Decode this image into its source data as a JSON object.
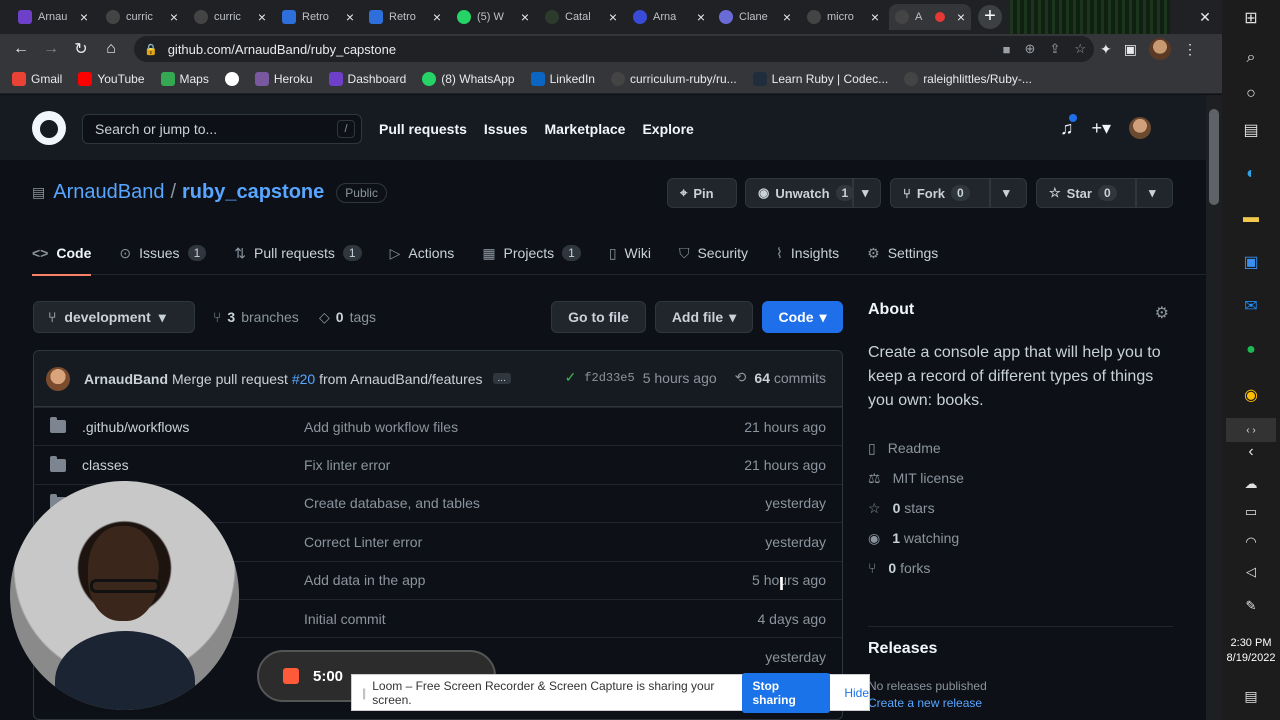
{
  "browser": {
    "tabs": [
      {
        "title": "Arnau",
        "color": "#6e40c9"
      },
      {
        "title": "curric",
        "color": "#444"
      },
      {
        "title": "curric",
        "color": "#444"
      },
      {
        "title": "Retro",
        "color": "#2f6fdb"
      },
      {
        "title": "Retro",
        "color": "#2f6fdb"
      },
      {
        "title": "(5) W",
        "color": "#25d366"
      },
      {
        "title": "Catal",
        "color": "#2d3b2d"
      },
      {
        "title": "Arna",
        "color": "#3a4bd8"
      },
      {
        "title": "Clane",
        "color": "#6b6bd8"
      },
      {
        "title": "micro",
        "color": "#444"
      },
      {
        "title": "A",
        "color": "#444"
      }
    ],
    "new_tab": "+",
    "url": "github.com/ArnaudBand/ruby_capstone",
    "bookmarks": [
      {
        "label": "Gmail",
        "color": "#ea4335"
      },
      {
        "label": "YouTube",
        "color": "#ff0000"
      },
      {
        "label": "Maps",
        "color": "#34a853"
      },
      {
        "label": "",
        "color": "#ffffff"
      },
      {
        "label": "Heroku",
        "color": "#79589f"
      },
      {
        "label": "Dashboard",
        "color": "#6e40c9"
      },
      {
        "label": "(8) WhatsApp",
        "color": "#25d366"
      },
      {
        "label": "LinkedIn",
        "color": "#0a66c2"
      },
      {
        "label": "curriculum-ruby/ru...",
        "color": "#444"
      },
      {
        "label": "Learn Ruby | Codec...",
        "color": "#1f2d3d"
      },
      {
        "label": "raleighlittles/Ruby-...",
        "color": "#444"
      }
    ]
  },
  "github": {
    "search_placeholder": "Search or jump to...",
    "search_key": "/",
    "nav": [
      "Pull requests",
      "Issues",
      "Marketplace",
      "Explore"
    ],
    "owner": "ArnaudBand",
    "repo": "ruby_capstone",
    "visibility": "Public",
    "pin": "Pin",
    "unwatch": "Unwatch",
    "unwatch_count": "1",
    "fork": "Fork",
    "fork_count": "0",
    "star": "Star",
    "star_count": "0",
    "tabs": [
      {
        "label": "Code",
        "count": ""
      },
      {
        "label": "Issues",
        "count": "1"
      },
      {
        "label": "Pull requests",
        "count": "1"
      },
      {
        "label": "Actions",
        "count": ""
      },
      {
        "label": "Projects",
        "count": "1"
      },
      {
        "label": "Wiki",
        "count": ""
      },
      {
        "label": "Security",
        "count": ""
      },
      {
        "label": "Insights",
        "count": ""
      },
      {
        "label": "Settings",
        "count": ""
      }
    ],
    "branch": "development",
    "branches_count": "3",
    "branches_label": "branches",
    "tags_count": "0",
    "tags_label": "tags",
    "go_to_file": "Go to file",
    "add_file": "Add file",
    "code": "Code",
    "commit": {
      "author": "ArnaudBand",
      "message_prefix": "Merge pull request",
      "pr": "#20",
      "message_suffix": "from ArnaudBand/features",
      "more": "...",
      "sha": "f2d33e5",
      "age": "5 hours ago",
      "commits_count": "64",
      "commits_label": "commits"
    },
    "files": [
      {
        "name": ".github/workflows",
        "message": "Add github workflow files",
        "age": "21 hours ago"
      },
      {
        "name": "classes",
        "message": "Fix linter error",
        "age": "21 hours ago"
      },
      {
        "name": "",
        "message": "Create database, and tables",
        "age": "yesterday"
      },
      {
        "name": "",
        "message": "Correct Linter error",
        "age": "yesterday"
      },
      {
        "name": "",
        "message": "Add data in the app",
        "age": "5 hours ago"
      },
      {
        "name": "",
        "message": "Initial commit",
        "age": "4 days ago"
      },
      {
        "name": "",
        "message": "",
        "age": "yesterday"
      }
    ],
    "about": {
      "title": "About",
      "description": "Create a console app that will help you to keep a record of different types of things you own: books.",
      "readme": "Readme",
      "license": "MIT license",
      "stars_count": "0",
      "stars_label": "stars",
      "watching_count": "1",
      "watching_label": "watching",
      "forks_count": "0",
      "forks_label": "forks"
    },
    "releases": {
      "title": "Releases",
      "none": "No releases published",
      "create": "Create a new release"
    }
  },
  "loom": {
    "timer": "5:00",
    "message": "Loom – Free Screen Recorder & Screen Capture is sharing your screen.",
    "stop_sharing": "Stop sharing",
    "hide": "Hide"
  },
  "taskbar": {
    "time": "2:30 PM",
    "date": "8/19/2022"
  }
}
